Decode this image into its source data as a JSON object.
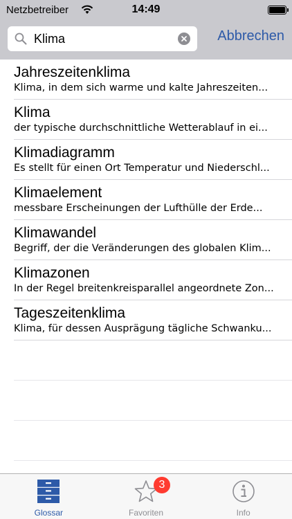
{
  "status_bar": {
    "carrier": "Netzbetreiber",
    "time": "14:49"
  },
  "search": {
    "value": "Klima",
    "cancel_label": "Abbrechen"
  },
  "results": [
    {
      "title": "Jahreszeitenklima",
      "description": "Klima, in dem sich warme und kalte Jahreszeiten..."
    },
    {
      "title": "Klima",
      "description": "der typische durchschnittliche Wetterablauf in ei..."
    },
    {
      "title": "Klimadiagramm",
      "description": "Es stellt für einen Ort Temperatur und Niederschl..."
    },
    {
      "title": "Klimaelement",
      "description": "messbare Erscheinungen der Lufthülle der Erde..."
    },
    {
      "title": "Klimawandel",
      "description": "Begriff, der die Veränderungen des globalen Klim..."
    },
    {
      "title": "Klimazonen",
      "description": "In der Regel breitenkreisparallel angeordnete Zon..."
    },
    {
      "title": "Tageszeitenklima",
      "description": "Klima, für dessen Ausprägung tägliche Schwanku..."
    }
  ],
  "tabs": [
    {
      "label": "Glossar",
      "icon": "drawer-icon",
      "active": true
    },
    {
      "label": "Favoriten",
      "icon": "star-icon",
      "badge": "3"
    },
    {
      "label": "Info",
      "icon": "info-icon"
    }
  ],
  "colors": {
    "accent": "#2d5aa8",
    "header_bg": "#c9c9ce",
    "badge": "#ff3b30"
  }
}
